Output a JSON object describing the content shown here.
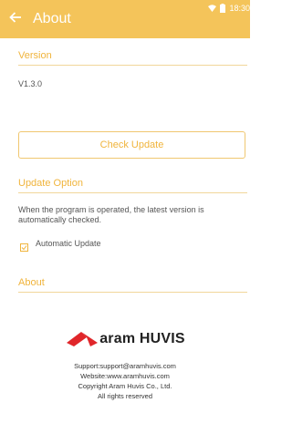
{
  "status": {
    "time": "18:30"
  },
  "header": {
    "title": "About"
  },
  "version": {
    "heading": "Version",
    "value": "V1.3.0"
  },
  "check_update": {
    "label": "Check Update"
  },
  "update_option": {
    "heading": "Update Option",
    "description_line1": "When the program is operated, the latest version is",
    "description_line2": "automatically checked.",
    "checkbox_label": "Automatic Update",
    "checked": true
  },
  "about": {
    "heading": "About",
    "logo_text": "aram HUVIS",
    "support": "Support:support@aramhuvis.com",
    "website": "Website:www.aramhuvis.com",
    "copyright": "Copyright Aram Huvis Co., Ltd.",
    "rights": "All rights reserved"
  },
  "colors": {
    "accent": "#f4c45a",
    "accent_text": "#f0b43c",
    "logo_red": "#e0262a"
  }
}
